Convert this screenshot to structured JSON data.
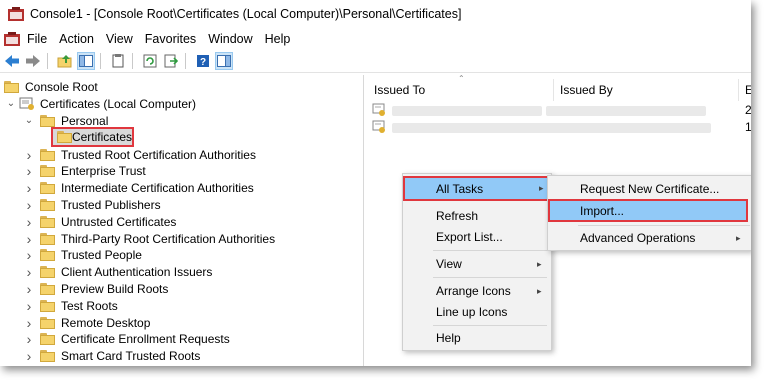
{
  "window": {
    "title": "Console1 - [Console Root\\Certificates (Local Computer)\\Personal\\Certificates]"
  },
  "menubar": {
    "items": [
      "File",
      "Action",
      "View",
      "Favorites",
      "Window",
      "Help"
    ]
  },
  "toolbar": {
    "icons": [
      "back-arrow-icon",
      "forward-arrow-icon",
      "up-folder-icon",
      "show-hide-tree-icon",
      "properties-icon",
      "refresh-icon",
      "export-list-icon",
      "help-icon",
      "action-pane-icon"
    ]
  },
  "tree": {
    "root": "Console Root",
    "snapin": "Certificates (Local Computer)",
    "personal": "Personal",
    "certificates": "Certificates",
    "items": [
      "Trusted Root Certification Authorities",
      "Enterprise Trust",
      "Intermediate Certification Authorities",
      "Trusted Publishers",
      "Untrusted Certificates",
      "Third-Party Root Certification Authorities",
      "Trusted People",
      "Client Authentication Issuers",
      "Preview Build Roots",
      "Test Roots",
      "Remote Desktop",
      "Certificate Enrollment Requests",
      "Smart Card Trusted Roots"
    ]
  },
  "list": {
    "columns": [
      "Issued To",
      "Issued By",
      "E"
    ],
    "row_expiry_partial": [
      "2",
      "1"
    ]
  },
  "context_menu": {
    "items": [
      "All Tasks",
      "Refresh",
      "Export List...",
      "View",
      "Arrange Icons",
      "Line up Icons",
      "Help"
    ]
  },
  "submenu": {
    "items": [
      "Request New Certificate...",
      "Import...",
      "Advanced Operations"
    ]
  },
  "colors": {
    "highlight": "#91c9f7",
    "callout_border": "#e0373e",
    "folder": "#f5d36b"
  }
}
